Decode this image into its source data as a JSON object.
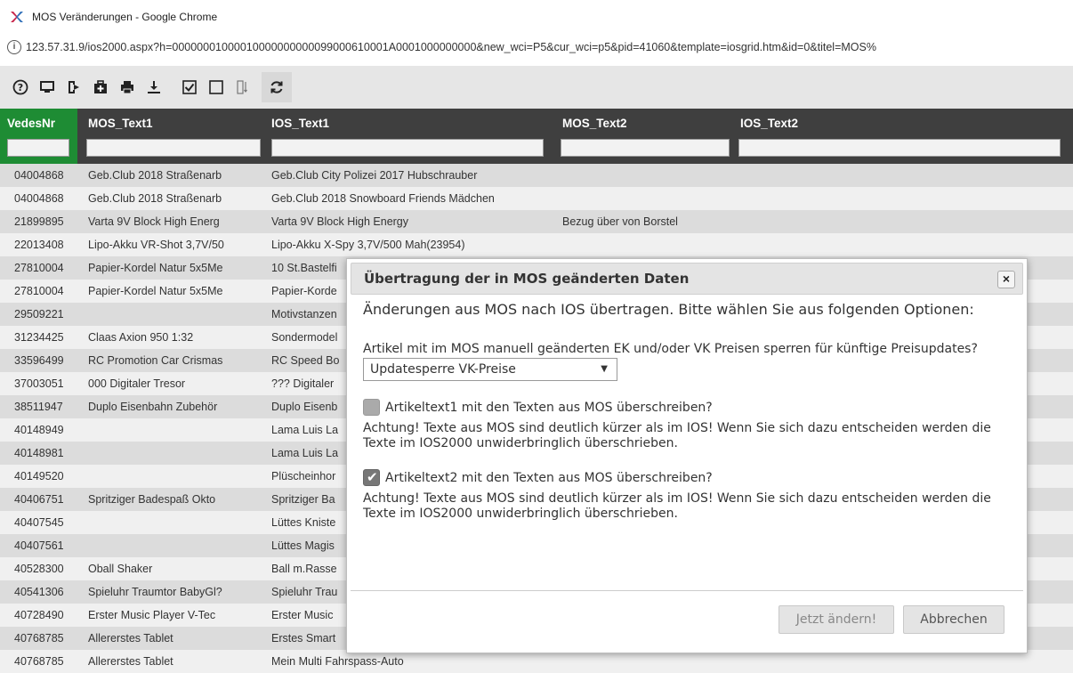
{
  "window": {
    "title": "MOS Veränderungen - Google Chrome"
  },
  "address": {
    "url": "123.57.31.9/ios2000.aspx?h=00000001000010000000000099000610001A0001000000000&new_wci=P5&cur_wci=p5&pid=41060&template=iosgrid.htm&id=0&titel=MOS%"
  },
  "toolbar": {
    "icons": [
      "help-icon",
      "monitor-icon",
      "export-icon",
      "medkit-icon",
      "print-icon",
      "download-icon",
      "checkbox-checked-icon",
      "checkbox-empty-icon",
      "column-sort-icon",
      "refresh-icon"
    ]
  },
  "grid": {
    "columns": [
      "VedesNr",
      "MOS_Text1",
      "IOS_Text1",
      "MOS_Text2",
      "IOS_Text2"
    ],
    "rows": [
      [
        "04004868",
        "Geb.Club 2018 Straßenarb",
        "Geb.Club City Polizei 2017 Hubschrauber",
        "",
        ""
      ],
      [
        "04004868",
        "Geb.Club 2018 Straßenarb",
        "Geb.Club 2018 Snowboard Friends Mädchen",
        "",
        ""
      ],
      [
        "21899895",
        "Varta 9V Block High Energ",
        "Varta 9V Block High Energy",
        "Bezug über von Borstel",
        ""
      ],
      [
        "22013408",
        "Lipo-Akku VR-Shot 3,7V/50",
        "Lipo-Akku X-Spy 3,7V/500 Mah(23954)",
        "",
        ""
      ],
      [
        "27810004",
        "Papier-Kordel Natur 5x5Me",
        "10 St.Bastelfi",
        "",
        ""
      ],
      [
        "27810004",
        "Papier-Kordel Natur 5x5Me",
        "Papier-Korde",
        "",
        ""
      ],
      [
        "29509221",
        "",
        "Motivstanzen",
        "",
        ""
      ],
      [
        "31234425",
        "Claas Axion 950 1:32",
        "Sondermodel",
        "",
        ""
      ],
      [
        "33596499",
        "RC Promotion Car Crismas",
        "RC Speed Bo",
        "",
        ""
      ],
      [
        "37003051",
        "000 Digitaler Tresor",
        "??? Digitaler",
        "",
        ""
      ],
      [
        "38511947",
        "Duplo Eisenbahn Zubehör",
        "Duplo Eisenb",
        "",
        ""
      ],
      [
        "40148949",
        "",
        "Lama Luis La",
        "",
        ""
      ],
      [
        "40148981",
        "",
        "Lama Luis La",
        "",
        ""
      ],
      [
        "40149520",
        "",
        "Plüscheinhor",
        "",
        ""
      ],
      [
        "40406751",
        "Spritziger Badespaß Okto",
        "Spritziger Ba",
        "",
        ""
      ],
      [
        "40407545",
        "",
        "Lüttes Kniste",
        "",
        ""
      ],
      [
        "40407561",
        "",
        "Lüttes Magis",
        "",
        ""
      ],
      [
        "40528300",
        "Oball Shaker",
        "Ball m.Rasse",
        "",
        ""
      ],
      [
        "40541306",
        "Spieluhr Traumtor BabyGl?",
        "Spieluhr Trau",
        "",
        ""
      ],
      [
        "40728490",
        "Erster Music Player V-Tec",
        "Erster Music",
        "",
        ""
      ],
      [
        "40768785",
        "Allererstes Tablet",
        "Erstes Smart",
        "",
        ""
      ],
      [
        "40768785",
        "Allererstes Tablet",
        "Mein Multi Fahrspass-Auto",
        "",
        ""
      ]
    ]
  },
  "dialog": {
    "title": "Übertragung der in MOS geänderten Daten",
    "close": "×",
    "intro": "Änderungen aus MOS nach IOS übertragen. Bitte wählen Sie aus folgenden Optionen:",
    "price_question": "Artikel mit im MOS manuell geänderten EK und/oder VK Preisen sperren für künftige Preisupdates?",
    "price_select": "Updatesperre VK-Preise",
    "opt1_label": "Artikeltext1 mit den Texten aus MOS überschreiben?",
    "opt1_checked": false,
    "opt1_warning": "Achtung! Texte aus MOS sind deutlich kürzer als im IOS! Wenn Sie sich dazu entscheiden werden die Texte im IOS2000 unwiderbringlich überschrieben.",
    "opt2_label": "Artikeltext2 mit den Texten aus MOS überschreiben?",
    "opt2_checked": true,
    "opt2_warning": "Achtung! Texte aus MOS sind deutlich kürzer als im IOS! Wenn Sie sich dazu entscheiden werden die Texte im IOS2000 unwiderbringlich überschrieben.",
    "ok_button": "Jetzt ändern!",
    "cancel_button": "Abbrechen"
  },
  "colors": {
    "header_bg": "#3f3f3f",
    "active_col": "#1e8c34",
    "row_odd": "#dcdcdc",
    "row_even": "#f0f0f0"
  }
}
